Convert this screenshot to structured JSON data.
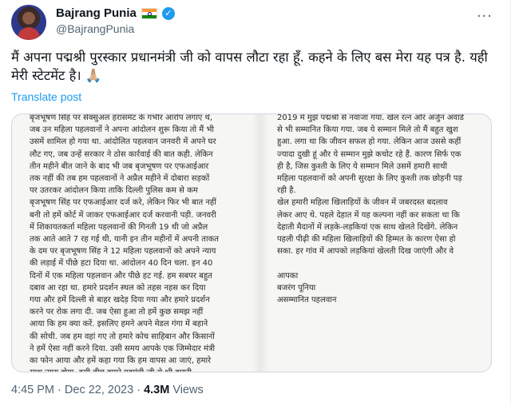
{
  "author": {
    "display_name": "Bajrang Punia",
    "handle": "@BajrangPunia",
    "flag_icon": "india-flag-icon",
    "verified_icon": "verified-badge-icon"
  },
  "tweet": {
    "text": "मैं अपना पद्मश्री पुरस्कार प्रधानमंत्री जी को वापस लौटा रहा हूँ. कहने के लिए बस मेरा यह पत्र है. यही मेरी स्टेटमेंट है। 🙏🏼",
    "translate_label": "Translate post"
  },
  "letter": {
    "left_column": "बृजभूषण सिंह पर सेक्सुअल हरासमेंट के गंभीर आरोप लगाए थे,\nजब उन महिला पहलवानों ने अपना आंदोलन शुरू किया तो मैं भी\nउसमें शामिल हो गया था. आंदोलित पहलवान जनवरी में अपने घर\nलौट गए, जब उन्हें सरकार ने ठोस कार्रवाई की बात कही. लेकिन\nतीन महीने बीत जाने के बाद भी जब बृजभूषण पर एफआईआर\nतक नहीं की तब हम पहलवानों ने अप्रैल महीने में दोबारा सड़कों\nपर उतरकर आंदोलन किया ताकि दिल्ली पुलिस कम से कम\nबृजभूषण सिंह पर एफआईआर दर्ज करे, लेकिन फिर भी बात नहीं\nबनी तो हमें कोर्ट में जाकर एफआईआर दर्ज करवानी पड़ी. जनवरी\nमें शिकायतकर्ता महिला पहलवानों की गिनती 19 थी जो अप्रैल\nतक आते आते 7 रह गई थी, यानी इन तीन महीनों में अपनी ताकत\nके दम पर बृजभूषण सिंह ने 12 महिला पहलवानों को अपने न्याय\nकी लड़ाई में पीछे हटा दिया था. आंदोलन 40 दिन चला. इन 40\nदिनों में एक महिला पहलवान और पीछे हट गई. हम सबपर बहुत\nदबाव आ रहा था. हमारे प्रदर्शन स्थल को तहस नहस कर दिया\nगया और हमें दिल्ली से बाहर खदेड़ दिया गया और हमारे प्रदर्शन\nकरने पर रोक लगा दी. जब ऐसा हुआ तो हमें कुछ समझ नहीं\nआया कि हम क्या करें. इसलिए हमने अपने मेडल गंगा में बहाने\nकी सोची. जब हम वहां गए तो हमारे कोच साहिबान और किसानों\nने हमें ऐसा नहीं करने दिया. उसी समय आपके एक जिम्मेदार मंत्री\nका फोन आया और हमें कहा गया कि हम वापस आ जाएं, हमारे\nसाथ न्याय होगा. इसी बीच हमारे गृहमंत्री जी से भी हमारी\nमुलाकात हुई, जिसमें उन्होंने हमें आश्वासन दिया कि वे महिला",
    "right_column": "2019 में मुझे पद्मश्री से नवाजा गया. खेल रत्न और अर्जुन अवार्ड\nसे भी सम्मानित किया गया. जब ये सम्मान मिले तो मैं बहुत खुश\nहुआ. लगा था कि जीवन सफल हो गया. लेकिन आज उससे कहीं\nज्यादा दुखी हूं और ये सम्मान मुझे कचोट रहे हैं. कारण सिर्फ एक\nही है, जिस कुश्ती के लिए ये सम्मान मिले उसमें हमारी साथी\nमहिला पहलवानों को अपनी सुरक्षा के लिए कुश्ती तक छोड़नी पड़\nरही है.\nखेल हमारी महिला खिलाड़ियों के जीवन में जबरदस्त बदलाव\nलेकर आए थे. पहले देहात में यह कल्पना नहीं कर सकता था कि\nदेहाती मैदानों में लड़के-लड़कियां एक साथ खेलते दिखेंगे. लेकिन\nपहली पीढ़ी की महिला खिलाड़ियों की हिम्मत के कारण ऐसा हो\nसका. हर गांव में आपको लड़कियां खेलती दिख जाएंगी और वे\n\nआपका\nबजरंग पूनिया\nअसम्मानित पहलवान"
  },
  "meta": {
    "time": "4:45 PM",
    "separator": "·",
    "date": "Dec 22, 2023",
    "views_count": "4.3M",
    "views_label": "Views"
  }
}
